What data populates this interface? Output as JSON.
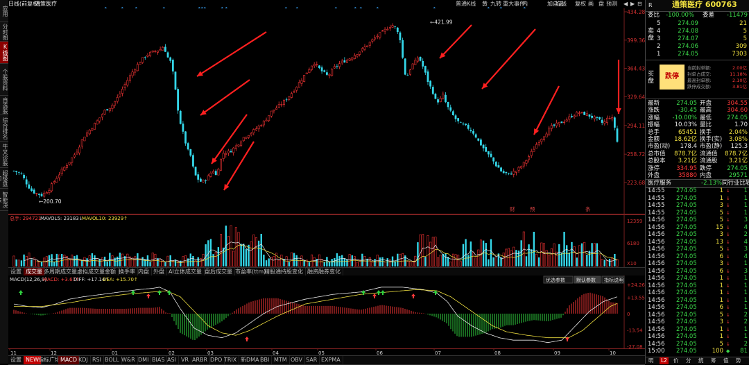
{
  "left_nav": [
    "应用",
    "分时图",
    "K线图",
    "个股资料",
    "自选股",
    "综合排名",
    "牛叉诊股",
    "超级盘口",
    "智能决策"
  ],
  "top": {
    "period": "日线(前复权)",
    "stock_name": "通策医疗",
    "toolbar": [
      "普通K线",
      "黄",
      "九转",
      "重大事件",
      "内",
      "加自选",
      "均线",
      "复权",
      "画",
      "盘",
      "预测"
    ],
    "diamonds_hint": "◆"
  },
  "kline": {
    "price_labels": [
      "434.28",
      "399.36",
      "364.43",
      "329.64",
      "294.11",
      "258.72",
      "223.68"
    ],
    "high_label": "421.99",
    "low_label": "200.70",
    "event_labels": [
      "财",
      "预",
      "条"
    ],
    "up_color": "#e33",
    "down_color": "#34d6e8"
  },
  "volume": {
    "legend_total": "总手: 294721",
    "legend_ma5": "MAVOL5: 23183↓",
    "legend_ma10": "MAVOL10: 23929↑",
    "axis": [
      "12359",
      "6180",
      "X10"
    ]
  },
  "vol_tabs": [
    "设置",
    "成交量",
    "多周期成交量",
    "虚拟成交量",
    "金额",
    "换手率",
    "内盘",
    "外盘",
    "AI立体成交量",
    "盘后成交量",
    "市盈率(ttm)",
    "精股通持股变化",
    "融资融券变化"
  ],
  "macd": {
    "legend_title": "MACD(12,26,9)",
    "legend_macd": "MACD: +3.67↑",
    "legend_diff": "DIFF: +17.14↑",
    "legend_dea": "DEA: +15.70↑",
    "buttons": [
      "优选参数",
      "默认参数",
      "指标说明"
    ],
    "axis": [
      "+24.26",
      "+13.55",
      "0",
      "-13.54",
      "-27.08"
    ]
  },
  "x_axis": [
    "11",
    "12",
    "01",
    "02",
    "03",
    "04",
    "05",
    "06",
    "07",
    "08",
    "09",
    "10"
  ],
  "bottom_tabs": [
    "设置",
    "NEW",
    "指标广场",
    "MACD",
    "KDJ",
    "RSI",
    "BOLL",
    "W&R",
    "DMI",
    "BIAS",
    "ASI",
    "VR",
    "ARBR",
    "DPO",
    "TRIX",
    "新DMA",
    "BBI",
    "MTM",
    "OBV",
    "SAR",
    "EXPMA"
  ],
  "right": {
    "r_label": "R",
    "title": "通策医疗 600763",
    "weibi_label": "委比",
    "weibi_val": "-100.00%",
    "weicha_label": "委差",
    "weicha_val": "-11479",
    "sell_label": "卖盘",
    "sells": [
      {
        "n": "5",
        "p": "274.09",
        "v": "21"
      },
      {
        "n": "4",
        "p": "274.08",
        "v": "5"
      },
      {
        "n": "3",
        "p": "274.07",
        "v": "5"
      },
      {
        "n": "2",
        "p": "274.06",
        "v": "309"
      },
      {
        "n": "1",
        "p": "274.05",
        "v": "7303"
      }
    ],
    "buy_label": "买盘",
    "limit_down": "跌停",
    "seal": [
      {
        "k": "当前封单额:",
        "v": "2.00亿"
      },
      {
        "k": "封单占成交:",
        "v": "11.18%"
      },
      {
        "k": "最高封单额:",
        "v": "2.10亿"
      },
      {
        "k": "跌停成交额:",
        "v": "3.81亿"
      }
    ],
    "quote": [
      {
        "k1": "最新",
        "v1": "274.05",
        "c1": "green",
        "k2": "开盘",
        "v2": "304.55",
        "c2": "red"
      },
      {
        "k1": "涨跌",
        "v1": "-30.45",
        "c1": "green",
        "k2": "最高",
        "v2": "304.60",
        "c2": "red"
      },
      {
        "k1": "涨幅",
        "v1": "-10.00%",
        "c1": "green",
        "k2": "最低",
        "v2": "274.05",
        "c2": "green"
      },
      {
        "k1": "振幅",
        "v1": "10.03%",
        "c1": "white",
        "k2": "量比",
        "v2": "1.70",
        "c2": "white"
      },
      {
        "k1": "总手",
        "v1": "65451",
        "c1": "yellow",
        "k2": "换手",
        "v2": "2.04%",
        "c2": "yellow"
      },
      {
        "k1": "金额",
        "v1": "18.62亿",
        "c1": "yellow",
        "k2": "换手(实)",
        "v2": "3.08%",
        "c2": "yellow"
      },
      {
        "k1": "市盈(动)",
        "v1": "178.4",
        "c1": "white",
        "k2": "市盈(静)",
        "v2": "125.3",
        "c2": "white"
      },
      {
        "k1": "总市值",
        "v1": "878.7亿",
        "c1": "yellow",
        "k2": "流通值",
        "v2": "878.7亿",
        "c2": "yellow"
      },
      {
        "k1": "总股本",
        "v1": "3.21亿",
        "c1": "yellow",
        "k2": "流通股",
        "v2": "3.21亿",
        "c2": "yellow"
      },
      {
        "k1": "涨停",
        "v1": "334.95",
        "c1": "red",
        "k2": "跌停",
        "v2": "274.05",
        "c2": "green"
      },
      {
        "k1": "外盘",
        "v1": "35880",
        "c1": "red",
        "k2": "内盘",
        "v2": "29571",
        "c2": "green"
      }
    ],
    "sector": "医疗服务",
    "sector_pct": "-2.13%",
    "sector_cmp": "同行业比较",
    "ticks": [
      {
        "t": "14:55",
        "p": "274.05",
        "v": "1",
        "d": "↓",
        "n": "1"
      },
      {
        "t": "14:55",
        "p": "274.05",
        "v": "1",
        "d": "↓",
        "n": "1"
      },
      {
        "t": "14:55",
        "p": "274.05",
        "v": "3",
        "d": "↓",
        "n": "1"
      },
      {
        "t": "14:55",
        "p": "274.05",
        "v": "5",
        "d": "↓",
        "n": "1"
      },
      {
        "t": "14:56",
        "p": "274.05",
        "v": "5",
        "d": "↓",
        "n": "3"
      },
      {
        "t": "14:56",
        "p": "274.05",
        "v": "15",
        "d": "↓",
        "n": "4"
      },
      {
        "t": "14:56",
        "p": "274.05",
        "v": "3",
        "d": "↓",
        "n": "2"
      },
      {
        "t": "14:56",
        "p": "274.05",
        "v": "13",
        "d": "↓",
        "n": "4"
      },
      {
        "t": "14:56",
        "p": "274.05",
        "v": "5",
        "d": "↓",
        "n": "3"
      },
      {
        "t": "14:56",
        "p": "274.05",
        "v": "6",
        "d": "↓",
        "n": "4"
      },
      {
        "t": "14:56",
        "p": "274.05",
        "v": "3",
        "d": "↓",
        "n": "1"
      },
      {
        "t": "14:56",
        "p": "274.05",
        "v": "6",
        "d": "↓",
        "n": "3"
      },
      {
        "t": "14:56",
        "p": "274.05",
        "v": "1",
        "d": "↓",
        "n": "1"
      },
      {
        "t": "14:56",
        "p": "274.05",
        "v": "1",
        "d": "↓",
        "n": "1"
      },
      {
        "t": "14:56",
        "p": "274.05",
        "v": "1",
        "d": "↓",
        "n": "1"
      },
      {
        "t": "14:56",
        "p": "274.05",
        "v": "1",
        "d": "↓",
        "n": "1"
      },
      {
        "t": "14:56",
        "p": "274.05",
        "v": "6",
        "d": "↓",
        "n": "1"
      },
      {
        "t": "14:56",
        "p": "274.05",
        "v": "5",
        "d": "↓",
        "n": "2"
      },
      {
        "t": "14:56",
        "p": "274.05",
        "v": "3",
        "d": "↓",
        "n": "2"
      },
      {
        "t": "14:56",
        "p": "274.05",
        "v": "1",
        "d": "↓",
        "n": "1"
      },
      {
        "t": "14:56",
        "p": "274.05",
        "v": "1",
        "d": "↓",
        "n": "1"
      },
      {
        "t": "14:56",
        "p": "274.05",
        "v": "5",
        "d": "↓",
        "n": "2"
      },
      {
        "t": "15:00",
        "p": "274.05",
        "v": "100",
        "d": "◆",
        "n": "81"
      }
    ],
    "bottom_tabs": [
      "明",
      "L2",
      "价",
      "分",
      "统",
      "筹",
      "值",
      "势"
    ]
  }
}
